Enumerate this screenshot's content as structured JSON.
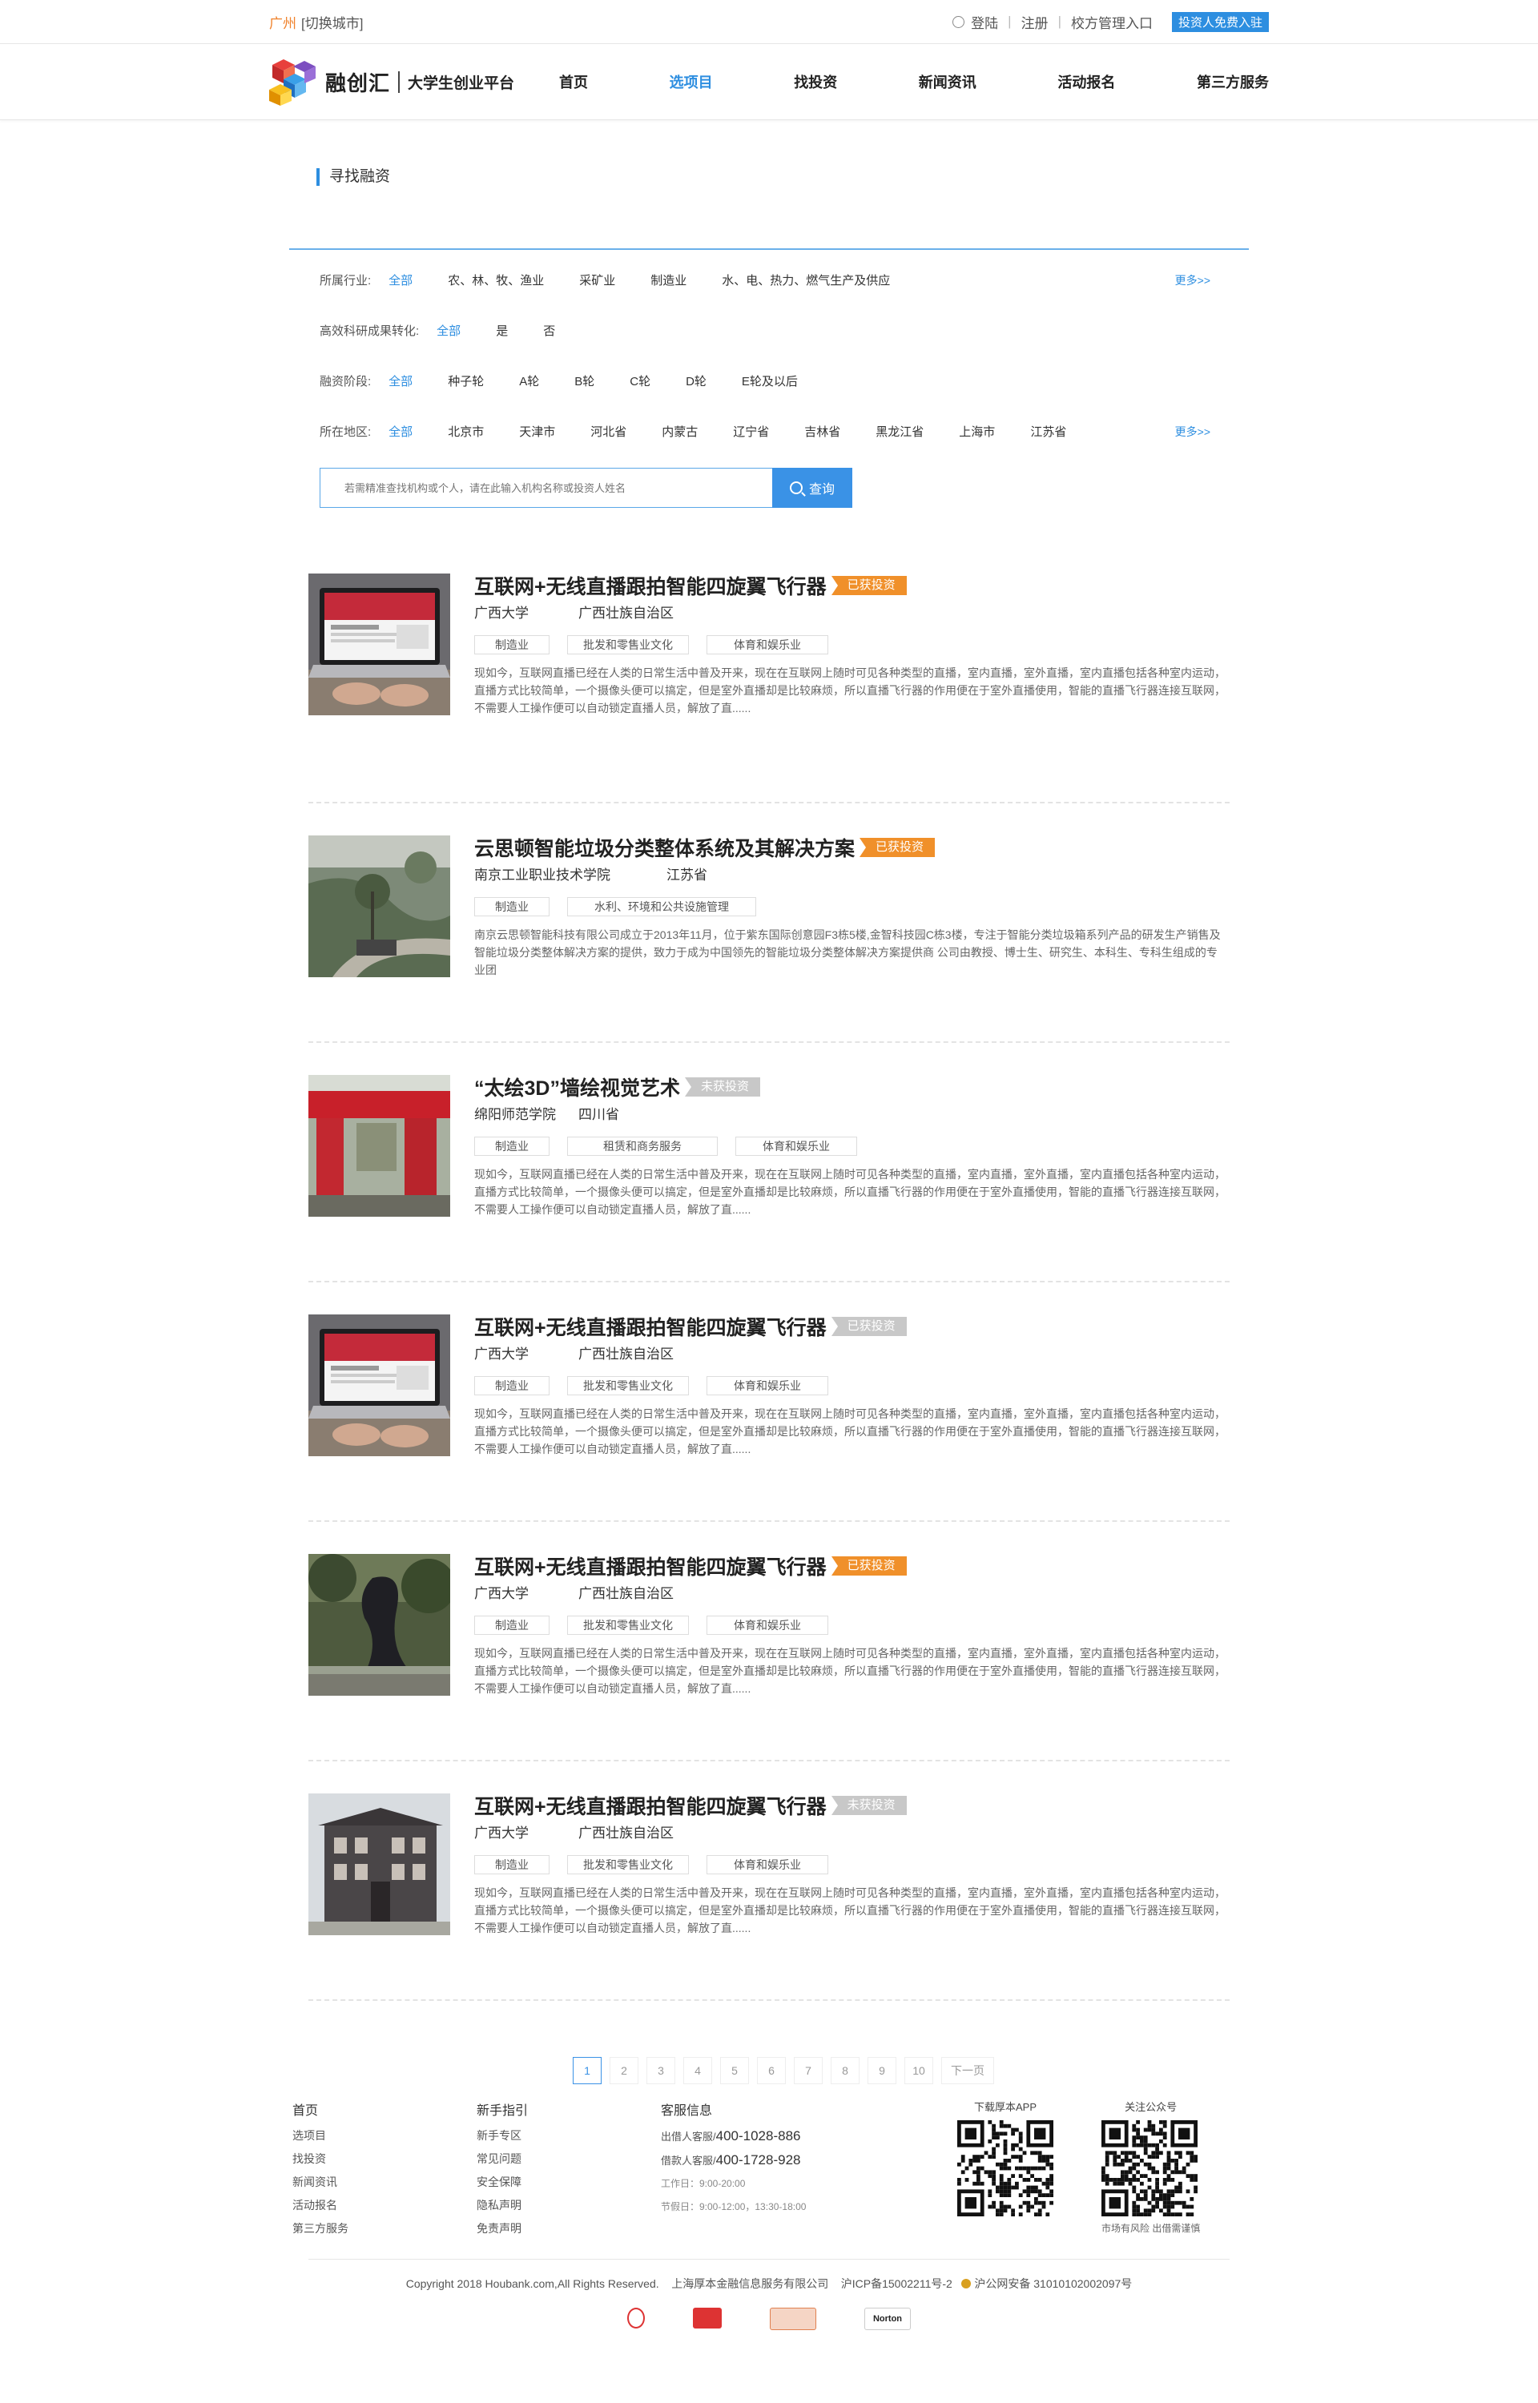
{
  "topbar": {
    "city": "广州",
    "switch_city": "[切换城市]",
    "login": "登陆",
    "register": "注册",
    "school_entry": "校方管理入口",
    "investor_join": "投资人免费入驻"
  },
  "header": {
    "logo_text": "融创汇",
    "logo_sub": "大学生创业平台",
    "nav": [
      {
        "label": "首页",
        "active": false
      },
      {
        "label": "选项目",
        "active": true
      },
      {
        "label": "找投资",
        "active": false
      },
      {
        "label": "新闻资讯",
        "active": false
      },
      {
        "label": "活动报名",
        "active": false
      },
      {
        "label": "第三方服务",
        "active": false
      }
    ]
  },
  "filter": {
    "title": "寻找融资",
    "more": "更多>>",
    "industry": {
      "label": "所属行业:",
      "options": [
        "全部",
        "农、林、牧、渔业",
        "采矿业",
        "制造业",
        "水、电、热力、燃气生产及供应"
      ]
    },
    "research": {
      "label": "高效科研成果转化:",
      "options": [
        "全部",
        "是",
        "否"
      ]
    },
    "stage": {
      "label": "融资阶段:",
      "options": [
        "全部",
        "种子轮",
        "A轮",
        "B轮",
        "C轮",
        "D轮",
        "E轮及以后"
      ]
    },
    "region": {
      "label": "所在地区:",
      "options": [
        "全部",
        "北京市",
        "天津市",
        "河北省",
        "内蒙古",
        "辽宁省",
        "吉林省",
        "黑龙江省",
        "上海市",
        "江苏省"
      ]
    },
    "search_placeholder": "若需精准查找机构或个人，请在此输入机构名称或投资人姓名",
    "search_button": "查询"
  },
  "projects": [
    {
      "title": "互联网+无线直播跟拍智能四旋翼飞行器",
      "status": "已获投资",
      "invested": true,
      "school": "广西大学",
      "region": "广西壮族自治区",
      "tags": [
        "制造业",
        "批发和零售业文化",
        "体育和娱乐业"
      ],
      "desc": "现如今，互联网直播已经在人类的日常生活中普及开来，现在在互联网上随时可见各种类型的直播，室内直播，室外直播，室内直播包括各种室内运动，直播方式比较简单，一个摄像头便可以搞定，但是室外直播却是比较麻烦，所以直播飞行器的作用便在于室外直播使用，智能的直播飞行器连接互联网，不需要人工操作便可以自动锁定直播人员，解放了直......",
      "image": "laptop"
    },
    {
      "title": "云思顿智能垃圾分类整体系统及其解决方案",
      "status": "已获投资",
      "invested": true,
      "school": "南京工业职业技术学院",
      "region": "江苏省",
      "tags": [
        "制造业",
        "水利、环境和公共设施管理"
      ],
      "desc": "南京云思顿智能科技有限公司成立于2013年11月，位于紫东国际创意园F3栋5楼,金智科技园C栋3楼，专注于智能分类垃圾箱系列产品的研发生产销售及智能垃圾分类整体解决方案的提供，致力于成为中国领先的智能垃圾分类整体解决方案提供商 公司由教授、博士生、研究生、本科生、专科生组成的专业团",
      "image": "park"
    },
    {
      "title": "“太绘3D”墙绘视觉艺术",
      "status": "未获投资",
      "invested": false,
      "school": "绵阳师范学院",
      "region": "四川省",
      "tags": [
        "制造业",
        "租赁和商务服务",
        "体育和娱乐业"
      ],
      "desc": "现如今，互联网直播已经在人类的日常生活中普及开来，现在在互联网上随时可见各种类型的直播，室内直播，室外直播，室内直播包括各种室内运动，直播方式比较简单，一个摄像头便可以搞定，但是室外直播却是比较麻烦，所以直播飞行器的作用便在于室外直播使用，智能的直播飞行器连接互联网，不需要人工操作便可以自动锁定直播人员，解放了直......",
      "image": "gate"
    },
    {
      "title": "互联网+无线直播跟拍智能四旋翼飞行器",
      "status": "已获投资",
      "invested": false,
      "school": "广西大学",
      "region": "广西壮族自治区",
      "tags": [
        "制造业",
        "批发和零售业文化",
        "体育和娱乐业"
      ],
      "desc": "现如今，互联网直播已经在人类的日常生活中普及开来，现在在互联网上随时可见各种类型的直播，室内直播，室外直播，室内直播包括各种室内运动，直播方式比较简单，一个摄像头便可以搞定，但是室外直播却是比较麻烦，所以直播飞行器的作用便在于室外直播使用，智能的直播飞行器连接互联网，不需要人工操作便可以自动锁定直播人员，解放了直......",
      "image": "laptop"
    },
    {
      "title": "互联网+无线直播跟拍智能四旋翼飞行器",
      "status": "已获投资",
      "invested": true,
      "school": "广西大学",
      "region": "广西壮族自治区",
      "tags": [
        "制造业",
        "批发和零售业文化",
        "体育和娱乐业"
      ],
      "desc": "现如今，互联网直播已经在人类的日常生活中普及开来，现在在互联网上随时可见各种类型的直播，室内直播，室外直播，室内直播包括各种室内运动，直播方式比较简单，一个摄像头便可以搞定，但是室外直播却是比较麻烦，所以直播飞行器的作用便在于室外直播使用，智能的直播飞行器连接互联网，不需要人工操作便可以自动锁定直播人员，解放了直......",
      "image": "sculpture"
    },
    {
      "title": "互联网+无线直播跟拍智能四旋翼飞行器",
      "status": "未获投资",
      "invested": false,
      "school": "广西大学",
      "region": "广西壮族自治区",
      "tags": [
        "制造业",
        "批发和零售业文化",
        "体育和娱乐业"
      ],
      "desc": "现如今，互联网直播已经在人类的日常生活中普及开来，现在在互联网上随时可见各种类型的直播，室内直播，室外直播，室内直播包括各种室内运动，直播方式比较简单，一个摄像头便可以搞定，但是室外直播却是比较麻烦，所以直播飞行器的作用便在于室外直播使用，智能的直播飞行器连接互联网，不需要人工操作便可以自动锁定直播人员，解放了直......",
      "image": "building"
    }
  ],
  "pager": {
    "pages": [
      "1",
      "2",
      "3",
      "4",
      "5",
      "6",
      "7",
      "8",
      "9",
      "10"
    ],
    "current": "1",
    "next": "下一页"
  },
  "footer": {
    "col1": {
      "title": "首页",
      "items": [
        "选项目",
        "找投资",
        "新闻资讯",
        "活动报名",
        "第三方服务"
      ]
    },
    "col2": {
      "title": "新手指引",
      "items": [
        "新手专区",
        "常见问题",
        "安全保障",
        "隐私声明",
        "免责声明"
      ]
    },
    "col3": {
      "title": "客服信息",
      "lender_label": "出借人客服/",
      "lender_phone": "400-1028-886",
      "borrower_label": "借款人客服/",
      "borrower_phone": "400-1728-928",
      "workday": "工作日：9:00-20:00",
      "holiday": "节假日：9:00-12:00，13:30-18:00"
    },
    "app_label": "下载厚本APP",
    "wechat_label": "关注公众号",
    "risk_note": "市场有风险 出借需谨慎",
    "copyright": "Copyright 2018 Houbank.com,All Rights Reserved.",
    "company": "上海厚本金融信息服务有限公司",
    "icp": "沪ICP备15002211号-2",
    "police": "沪公网安备 31010102002097号",
    "seal_labels": [
      "",
      "",
      "",
      "Norton"
    ]
  }
}
